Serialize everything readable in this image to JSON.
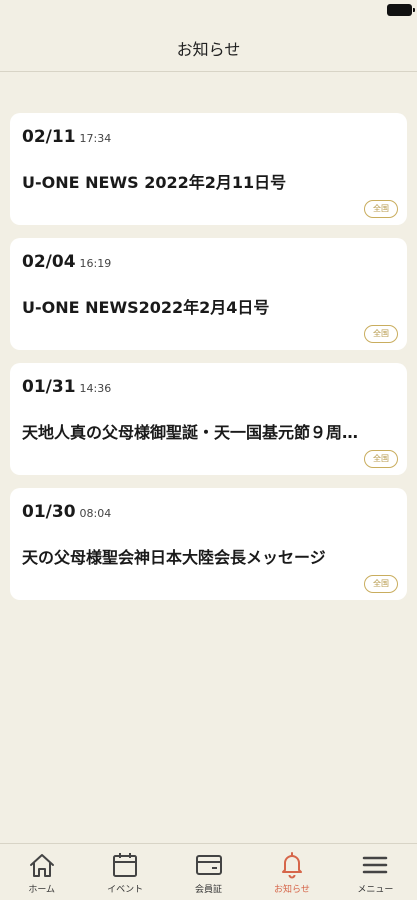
{
  "header": {
    "title": "お知らせ"
  },
  "news": [
    {
      "date": "02/11",
      "time": "17:34",
      "title": "U-ONE NEWS 2022年2月11日号",
      "badge": "全国"
    },
    {
      "date": "02/04",
      "time": "16:19",
      "title": "U-ONE NEWS2022年2月4日号",
      "badge": "全国"
    },
    {
      "date": "01/31",
      "time": "14:36",
      "title": "天地人真の父母様御聖誕・天一国基元節９周…",
      "badge": "全国"
    },
    {
      "date": "01/30",
      "time": "08:04",
      "title": "天の父母様聖会神日本大陸会長メッセージ",
      "badge": "全国"
    }
  ],
  "tabbar": {
    "items": [
      {
        "label": "ホーム",
        "icon": "home-icon"
      },
      {
        "label": "イベント",
        "icon": "calendar-icon"
      },
      {
        "label": "会員証",
        "icon": "member-card-icon"
      },
      {
        "label": "お知らせ",
        "icon": "bell-icon"
      },
      {
        "label": "メニュー",
        "icon": "menu-icon"
      }
    ],
    "active_index": 3
  },
  "colors": {
    "background": "#f2efe4",
    "card": "#ffffff",
    "badge": "#c9ad5e",
    "active_tab": "#d6664a",
    "icon": "#444444"
  }
}
